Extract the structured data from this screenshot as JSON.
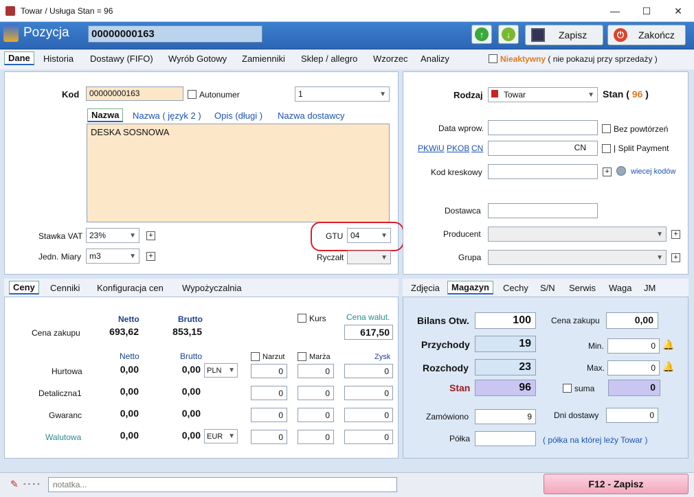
{
  "window": {
    "title": "Towar / Usługa   Stan = 96",
    "min": "—",
    "max": "☐",
    "close": "✕"
  },
  "header": {
    "title": "Pozycja",
    "code": "00000000163",
    "save_label": "Zapisz",
    "finish_label": "Zakończ"
  },
  "tabs": [
    "Dane",
    "Historia",
    "Dostawy (FIFO)",
    "Wyrób Gotowy",
    "Zamienniki",
    "Sklep / allegro",
    "Wzorzec",
    "Analizy"
  ],
  "inactive": {
    "label": "Nieaktywny",
    "note": "( nie pokazuj przy sprzedaży )"
  },
  "left": {
    "kod_label": "Kod",
    "kod_value": "00000000163",
    "autonumer_label": "Autonumer",
    "num_select": "1",
    "name_tabs": [
      "Nazwa",
      "Nazwa ( język 2 )",
      "Opis (długi )",
      "Nazwa dostawcy"
    ],
    "name_value": "DESKA SOSNOWA",
    "vat_label": "Stawka VAT",
    "vat_value": "23%",
    "unit_label": "Jedn. Miary",
    "unit_value": "m3",
    "gtu_label": "GTU",
    "gtu_value": "04",
    "ryczalt_label": "Ryczałt"
  },
  "right": {
    "rodzaj_label": "Rodzaj",
    "rodzaj_value": "Towar",
    "stan_prefix": "Stan (",
    "stan_value": "96",
    "stan_suffix": ")",
    "data_label": "Data wprow.",
    "bez_label": "Bez powtórzeń",
    "pkwiu": "PKWiU",
    "pkob": "PKOB",
    "cn": "CN",
    "cn_value": "CN",
    "split_label": "| Split Payment",
    "kod_kresk_label": "Kod kreskowy",
    "wiecej_label": "wiecej kodów",
    "dostawca_label": "Dostawca",
    "producent_label": "Producent",
    "grupa_label": "Grupa"
  },
  "prices": {
    "tabs": [
      "Ceny",
      "Cenniki",
      "Konfiguracja cen",
      "Wypożyczalnia"
    ],
    "netto": "Netto",
    "brutto": "Brutto",
    "kurs_label": "Kurs",
    "cena_walut_label": "Cena walut.",
    "cena_zakupu_label": "Cena zakupu",
    "cena_zakupu_netto": "693,62",
    "cena_zakupu_brutto": "853,15",
    "cena_walut_value": "617,50",
    "narzut_label": "Narzut",
    "marza_label": "Marża",
    "zysk_label": "Zysk",
    "rows": [
      {
        "label": "Hurtowa",
        "netto": "0,00",
        "brutto": "0,00",
        "currency": "PLN",
        "narzut": "0",
        "marza": "0",
        "zysk": "0"
      },
      {
        "label": "Detaliczna1",
        "netto": "0,00",
        "brutto": "0,00",
        "currency": "",
        "narzut": "0",
        "marza": "0",
        "zysk": "0"
      },
      {
        "label": "Gwaranc",
        "netto": "0,00",
        "brutto": "0,00",
        "currency": "",
        "narzut": "0",
        "marza": "0",
        "zysk": "0"
      },
      {
        "label": "Walutowa",
        "netto": "0,00",
        "brutto": "0,00",
        "currency": "EUR",
        "narzut": "0",
        "marza": "0",
        "zysk": "0"
      }
    ]
  },
  "magazyn": {
    "tabs": [
      "Zdjęcia",
      "Magazyn",
      "Cechy",
      "S/N",
      "Serwis",
      "Waga",
      "JM"
    ],
    "bilans_label": "Bilans Otw.",
    "bilans_value": "100",
    "przychody_label": "Przychody",
    "przychody_value": "19",
    "rozchody_label": "Rozchody",
    "rozchody_value": "23",
    "stan_label": "Stan",
    "stan_value": "96",
    "zamowiono_label": "Zamówiono",
    "zamowiono_value": "9",
    "polka_label": "Półka",
    "polka_note": "( półka na której leży Towar )",
    "cena_zakupu_label": "Cena zakupu",
    "cena_zakupu_value": "0,00",
    "min_label": "Min.",
    "min_value": "0",
    "max_label": "Max.",
    "max_value": "0",
    "suma_label": "suma",
    "suma_value": "0",
    "dni_label": "Dni dostawy",
    "dni_value": "0"
  },
  "footer": {
    "dashes": "- - - -",
    "note_placeholder": "notatka...",
    "save_label": "F12 - Zapisz"
  }
}
